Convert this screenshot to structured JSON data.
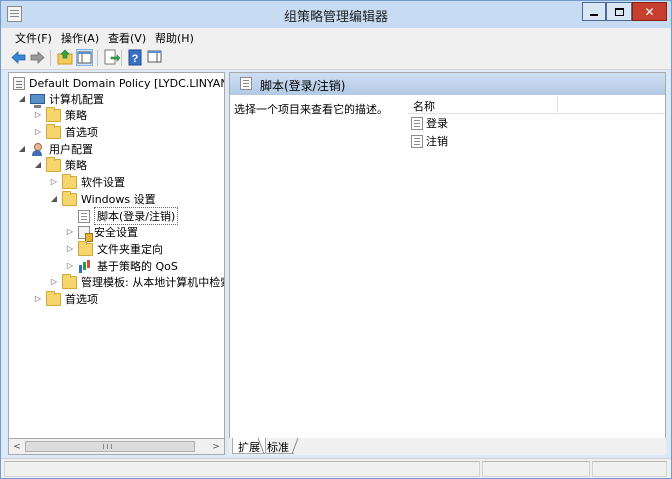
{
  "window": {
    "title": "组策略管理编辑器",
    "close_glyph": "✕"
  },
  "menu": {
    "items": [
      "文件(F)",
      "操作(A)",
      "查看(V)",
      "帮助(H)"
    ]
  },
  "toolbar": {
    "buttons": [
      "back-icon",
      "forward-icon",
      "up-folder-icon",
      "show-hide-tree-icon",
      "export-list-icon",
      "help-icon",
      "show-hide-pane-icon"
    ]
  },
  "tree": {
    "root": "Default Domain Policy [LYDC.LINYANGR",
    "computer_config": "计算机配置",
    "cc_policies": "策略",
    "cc_preferences": "首选项",
    "user_config": "用户配置",
    "uc_policies": "策略",
    "software_settings": "软件设置",
    "windows_settings": "Windows 设置",
    "scripts": "脚本(登录/注销)",
    "security_settings": "安全设置",
    "folder_redirection": "文件夹重定向",
    "policy_qos": "基于策略的 QoS",
    "admin_templates": "管理模板: 从本地计算机中检索的",
    "uc_preferences": "首选项"
  },
  "scrollbar": {
    "left_arrow": "<",
    "right_arrow": ">"
  },
  "detail": {
    "header_title": "脚本(登录/注销)",
    "description": "选择一个项目来查看它的描述。",
    "column_name": "名称",
    "items": [
      "登录",
      "注销"
    ]
  },
  "tabs": {
    "expand": "扩展",
    "standard": "标准"
  }
}
